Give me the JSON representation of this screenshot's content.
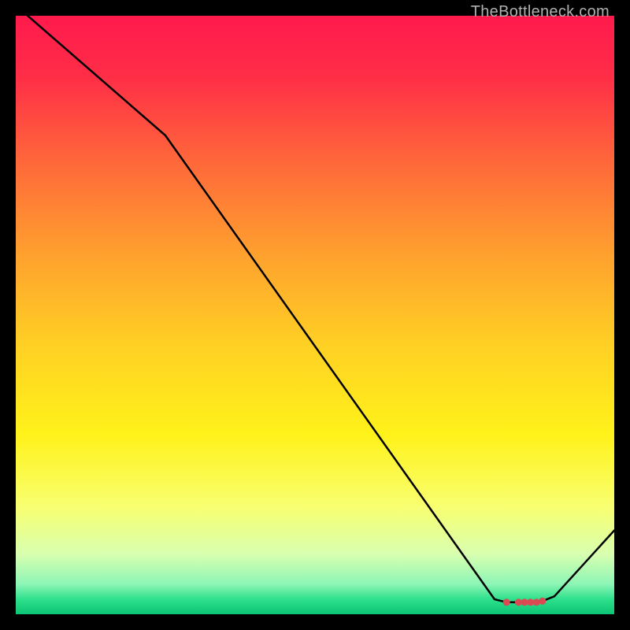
{
  "watermark": "TheBottleneck.com",
  "chart_data": {
    "type": "line",
    "title": "",
    "xlabel": "",
    "ylabel": "",
    "xlim": [
      0,
      100
    ],
    "ylim": [
      0,
      100
    ],
    "x": [
      0,
      2,
      25,
      80,
      82,
      84,
      85,
      86,
      87,
      88,
      90,
      100
    ],
    "values": [
      103,
      100,
      80,
      2.5,
      2,
      2,
      2,
      2,
      2,
      2.2,
      3,
      14
    ],
    "optimum_markers_x": [
      82,
      84,
      85,
      86,
      87,
      88
    ],
    "optimum_markers_y": [
      2,
      2,
      2,
      2,
      2,
      2.2
    ],
    "gradient_stops": [
      {
        "pos": 0.0,
        "color": "#ff1a4d"
      },
      {
        "pos": 0.1,
        "color": "#ff2d47"
      },
      {
        "pos": 0.25,
        "color": "#ff6a3a"
      },
      {
        "pos": 0.4,
        "color": "#ffa12e"
      },
      {
        "pos": 0.55,
        "color": "#ffd024"
      },
      {
        "pos": 0.7,
        "color": "#fff21a"
      },
      {
        "pos": 0.82,
        "color": "#f8ff70"
      },
      {
        "pos": 0.9,
        "color": "#d8ffb0"
      },
      {
        "pos": 0.95,
        "color": "#8cf5b5"
      },
      {
        "pos": 0.975,
        "color": "#2ee08c"
      },
      {
        "pos": 1.0,
        "color": "#0cc474"
      }
    ],
    "marker_color": "#d94a52",
    "line_color": "#000000"
  }
}
